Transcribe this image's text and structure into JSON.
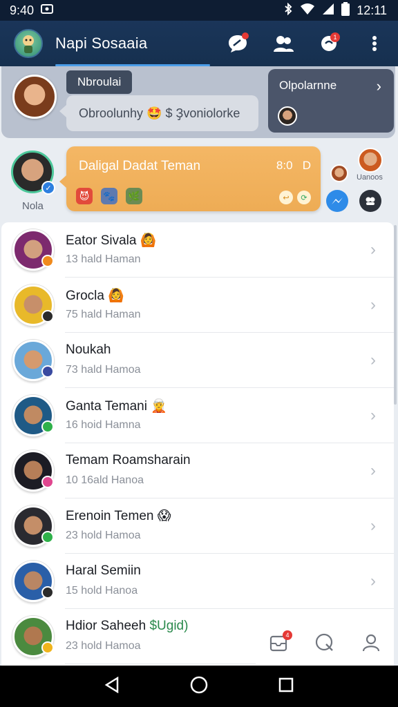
{
  "status_bar": {
    "time_left": "9:40",
    "time_right": "12:11"
  },
  "app_bar": {
    "title": "Napi Sosaaia",
    "badge_1": "",
    "badge_2": "1"
  },
  "stories": {
    "chip_label": "Nbroulai",
    "bubble_text": "Obroolunhy 🤩 $ Ҙvoniolorke",
    "panel_title": "Olpolarnne"
  },
  "highlight": {
    "user_name": "Nola",
    "card_title": "Daligal Dadat Teman",
    "card_time": "8:0",
    "card_letter": "D",
    "side_user_name": "Uanoos",
    "emojis": [
      "😈",
      "🐾",
      "🌿"
    ]
  },
  "chats": [
    {
      "name": "Eator Sivala",
      "emoji": "🙆",
      "sub": "13 hald Haman",
      "status_color": "#f08a1c",
      "avatar_bg": "#7d2a6e",
      "face": "#d2a07f"
    },
    {
      "name": "Grocla",
      "emoji": "🙆",
      "sub": "75 hald Haman",
      "status_color": "#2b2b2b",
      "avatar_bg": "#e8b92a",
      "face": "#c78f6a"
    },
    {
      "name": "Noukah",
      "emoji": "",
      "sub": "73 hald Hamoa",
      "status_color": "#3a4aa0",
      "avatar_bg": "#6aa8d9",
      "face": "#d59a6e"
    },
    {
      "name": "Ganta Temani",
      "emoji": "🧝",
      "sub": "16 hoid Hamna",
      "status_color": "#2fb14a",
      "avatar_bg": "#1f5a86",
      "face": "#c08a62"
    },
    {
      "name": "Temam Roamsharain",
      "emoji": "",
      "sub": "10 16ald Hanoa",
      "status_color": "#e0468f",
      "avatar_bg": "#1c1c24",
      "face": "#b67e58"
    },
    {
      "name": "Erenoin Temen",
      "emoji": "😱",
      "sub": "23 hold Hamoa",
      "status_color": "#2fb14a",
      "avatar_bg": "#2a2a30",
      "face": "#c48e68"
    },
    {
      "name": "Haral Semiin",
      "emoji": "",
      "sub": "15 hold Hanoa",
      "status_color": "#2b2b2b",
      "avatar_bg": "#2a5fa8",
      "face": "#b98664"
    },
    {
      "name": "Hdior Saheeh",
      "emoji": "",
      "extra": "$Ugid)",
      "sub": "23 hold Hamoa",
      "status_color": "#f0b41c",
      "avatar_bg": "#4b8a3f",
      "face": "#b0784f"
    }
  ],
  "mini_nav": {
    "badge": "4"
  },
  "colors": {
    "accent": "#4a9de8",
    "appbar": "#16304f",
    "highlight": "#f0b05c"
  }
}
